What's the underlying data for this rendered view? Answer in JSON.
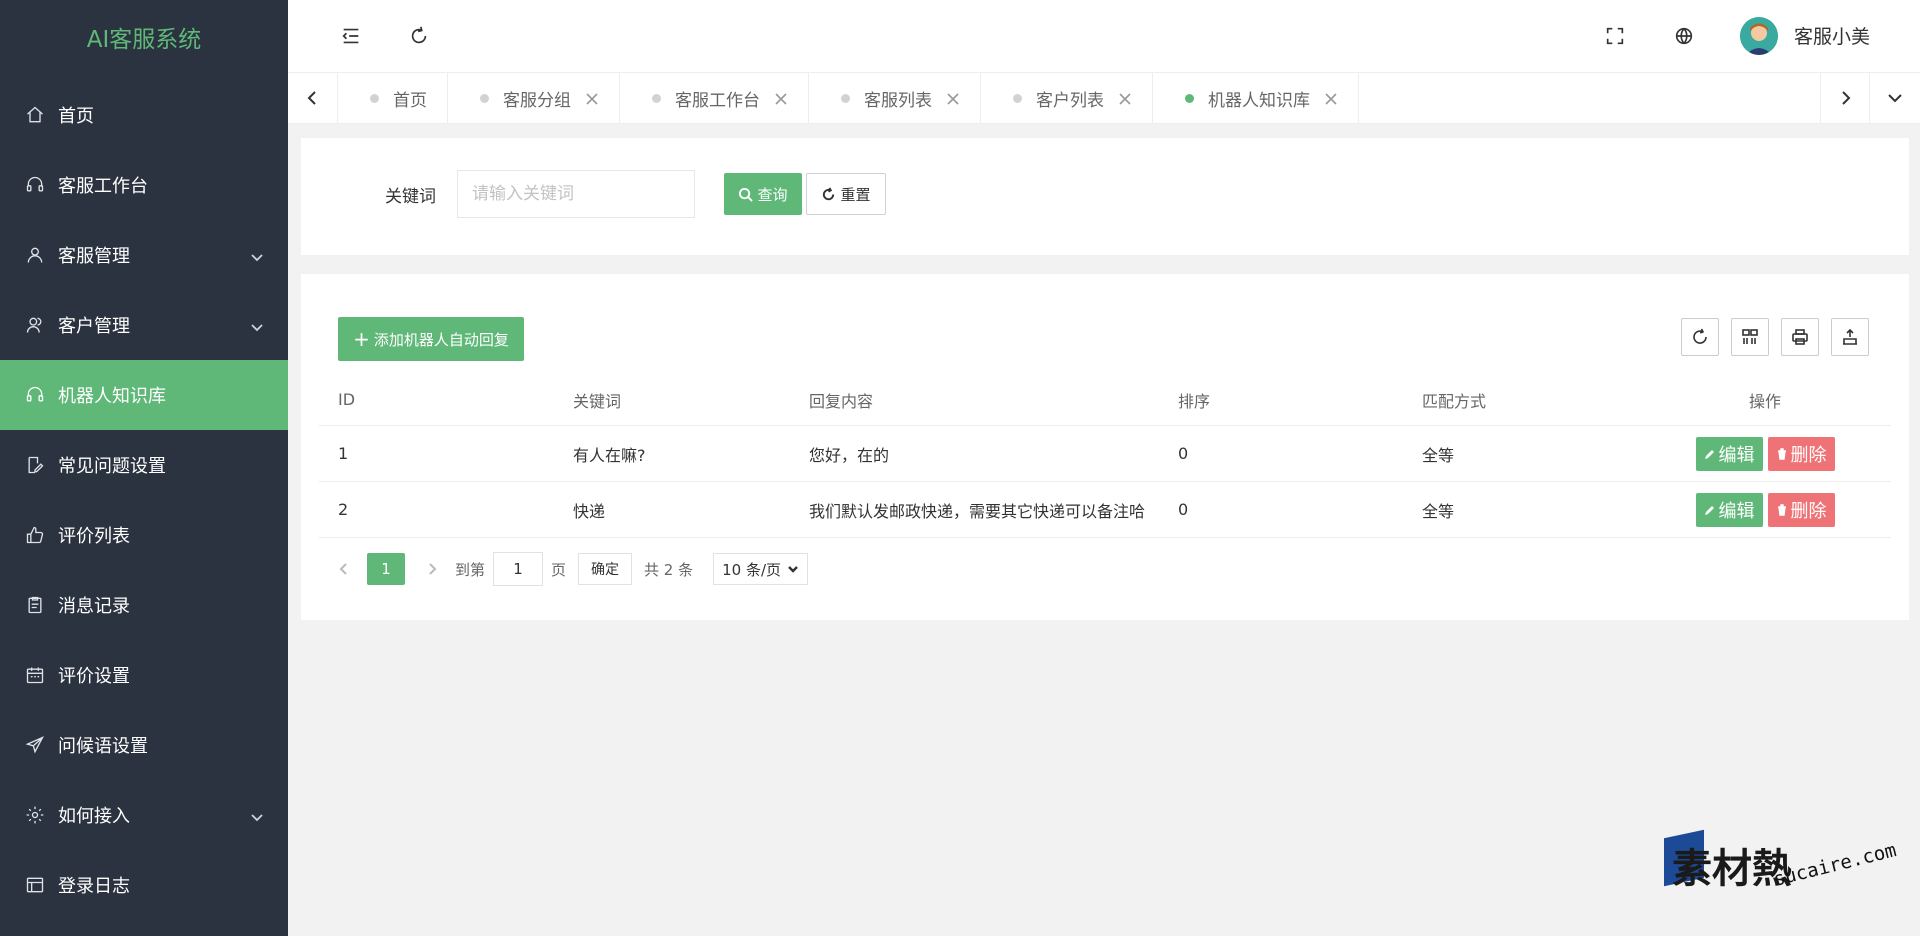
{
  "sidebar": {
    "brand": "AI客服系统",
    "items": [
      {
        "label": "首页"
      },
      {
        "label": "客服工作台"
      },
      {
        "label": "客服管理"
      },
      {
        "label": "客户管理"
      },
      {
        "label": "机器人知识库"
      },
      {
        "label": "常见问题设置"
      },
      {
        "label": "评价列表"
      },
      {
        "label": "消息记录"
      },
      {
        "label": "评价设置"
      },
      {
        "label": "问候语设置"
      },
      {
        "label": "如何接入"
      },
      {
        "label": "登录日志"
      }
    ],
    "active_item": "机器人知识库",
    "accent_color": "#5fb878",
    "bg_color": "#2a333f"
  },
  "header": {
    "user_name": "客服小美",
    "icons": [
      "menu-collapse-icon",
      "refresh-icon",
      "fullscreen-icon",
      "globe-icon"
    ]
  },
  "tabs": {
    "items": [
      {
        "label": "首页"
      },
      {
        "label": "客服分组"
      },
      {
        "label": "客服工作台"
      },
      {
        "label": "客服列表"
      },
      {
        "label": "客户列表"
      },
      {
        "label": "机器人知识库"
      }
    ],
    "active": "机器人知识库"
  },
  "search": {
    "label": "关键词",
    "placeholder": "请输入关键词",
    "value": "",
    "query_label": "查询",
    "reset_label": "重置"
  },
  "table": {
    "add_label": "添加机器人自动回复",
    "columns": [
      "ID",
      "关键词",
      "回复内容",
      "排序",
      "匹配方式",
      "操作"
    ],
    "rows": [
      {
        "id": "1",
        "keyword": "有人在嘛?",
        "reply": "您好，在的",
        "sort": "0",
        "match": "全等"
      },
      {
        "id": "2",
        "keyword": "快递",
        "reply": "我们默认发邮政快递，需要其它快递可以备注哈",
        "sort": "0",
        "match": "全等"
      }
    ],
    "edit_label": "编辑",
    "delete_label": "删除",
    "toolbar_icons": [
      "refresh-icon",
      "columns-icon",
      "print-icon",
      "export-icon"
    ]
  },
  "pager": {
    "current_page": "1",
    "goto_prefix": "到第",
    "goto_value": "1",
    "goto_suffix": "页",
    "confirm_label": "确定",
    "total_text": "共 2 条",
    "page_size": "10 条/页"
  },
  "watermark": {
    "text": "素材熱",
    "sub": "sucaire.com"
  }
}
